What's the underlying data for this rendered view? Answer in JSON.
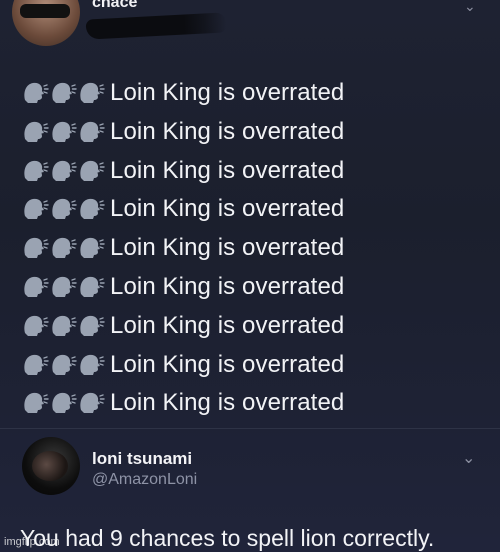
{
  "top_tweet": {
    "handle": "chace",
    "menu_icon": "chevron-down-icon",
    "repeated_line": {
      "emoji": "speaking-head-icon",
      "emoji_count": 3,
      "text": "Loin King is overrated"
    },
    "lines": [
      "Loin King is overrated",
      "Loin King is overrated",
      "Loin King is overrated",
      "Loin King is overrated",
      "Loin King is overrated",
      "Loin King is overrated",
      "Loin King is overrated",
      "Loin King is overrated",
      "Loin King is overrated"
    ]
  },
  "reply": {
    "display_name": "loni tsunami",
    "handle": "@AmazonLoni",
    "menu_icon": "chevron-down-icon",
    "text": "You had 9 chances to spell lion correctly."
  },
  "watermark": "imgflip.com",
  "colors": {
    "background": "#1d2130",
    "text": "#f2f3f6",
    "secondary_text": "#8e93a6"
  }
}
